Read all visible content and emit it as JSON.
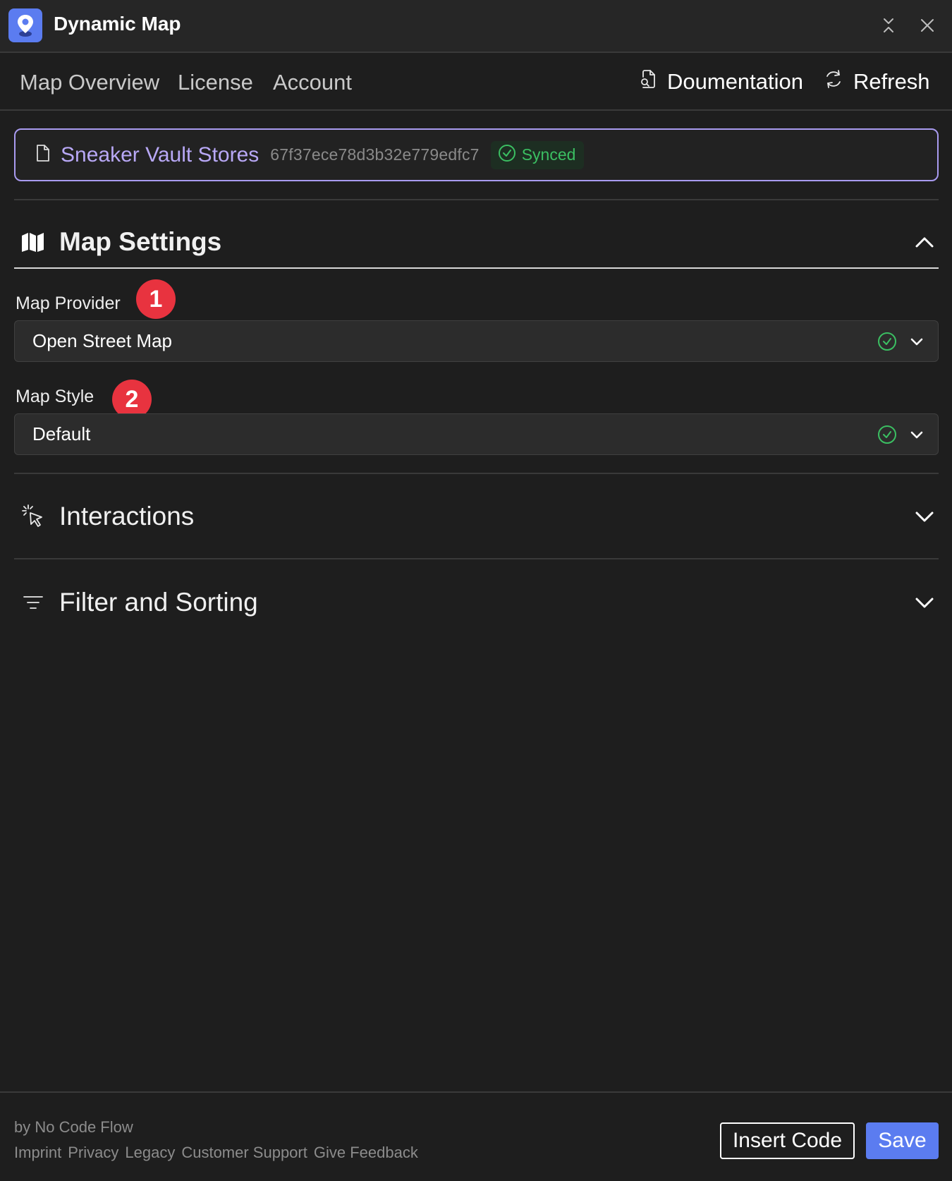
{
  "window": {
    "title": "Dynamic Map",
    "logo_icon": "map-pin-icon",
    "accent_color": "#5b7cf0"
  },
  "nav": {
    "tabs": [
      {
        "label": "Map Overview"
      },
      {
        "label": "License"
      },
      {
        "label": "Account"
      }
    ],
    "documentation_label": "Doumentation",
    "refresh_label": "Refresh"
  },
  "collection": {
    "name": "Sneaker Vault Stores",
    "id": "67f37ece78d3b32e779edfc7",
    "status": "Synced",
    "name_color": "#b8a8f6",
    "status_color": "#3bbf62"
  },
  "map_settings": {
    "title": "Map Settings",
    "expanded": true,
    "provider": {
      "label": "Map Provider",
      "value": "Open Street Map",
      "marker": "1"
    },
    "style": {
      "label": "Map Style",
      "value": "Default",
      "marker": "2"
    }
  },
  "sections": {
    "interactions": "Interactions",
    "filter_sorting": "Filter and Sorting"
  },
  "footer": {
    "by": "by No Code Flow",
    "links": [
      "Imprint",
      "Privacy",
      "Legacy",
      "Customer Support",
      "Give Feedback"
    ],
    "insert_code": "Insert Code",
    "save": "Save"
  }
}
